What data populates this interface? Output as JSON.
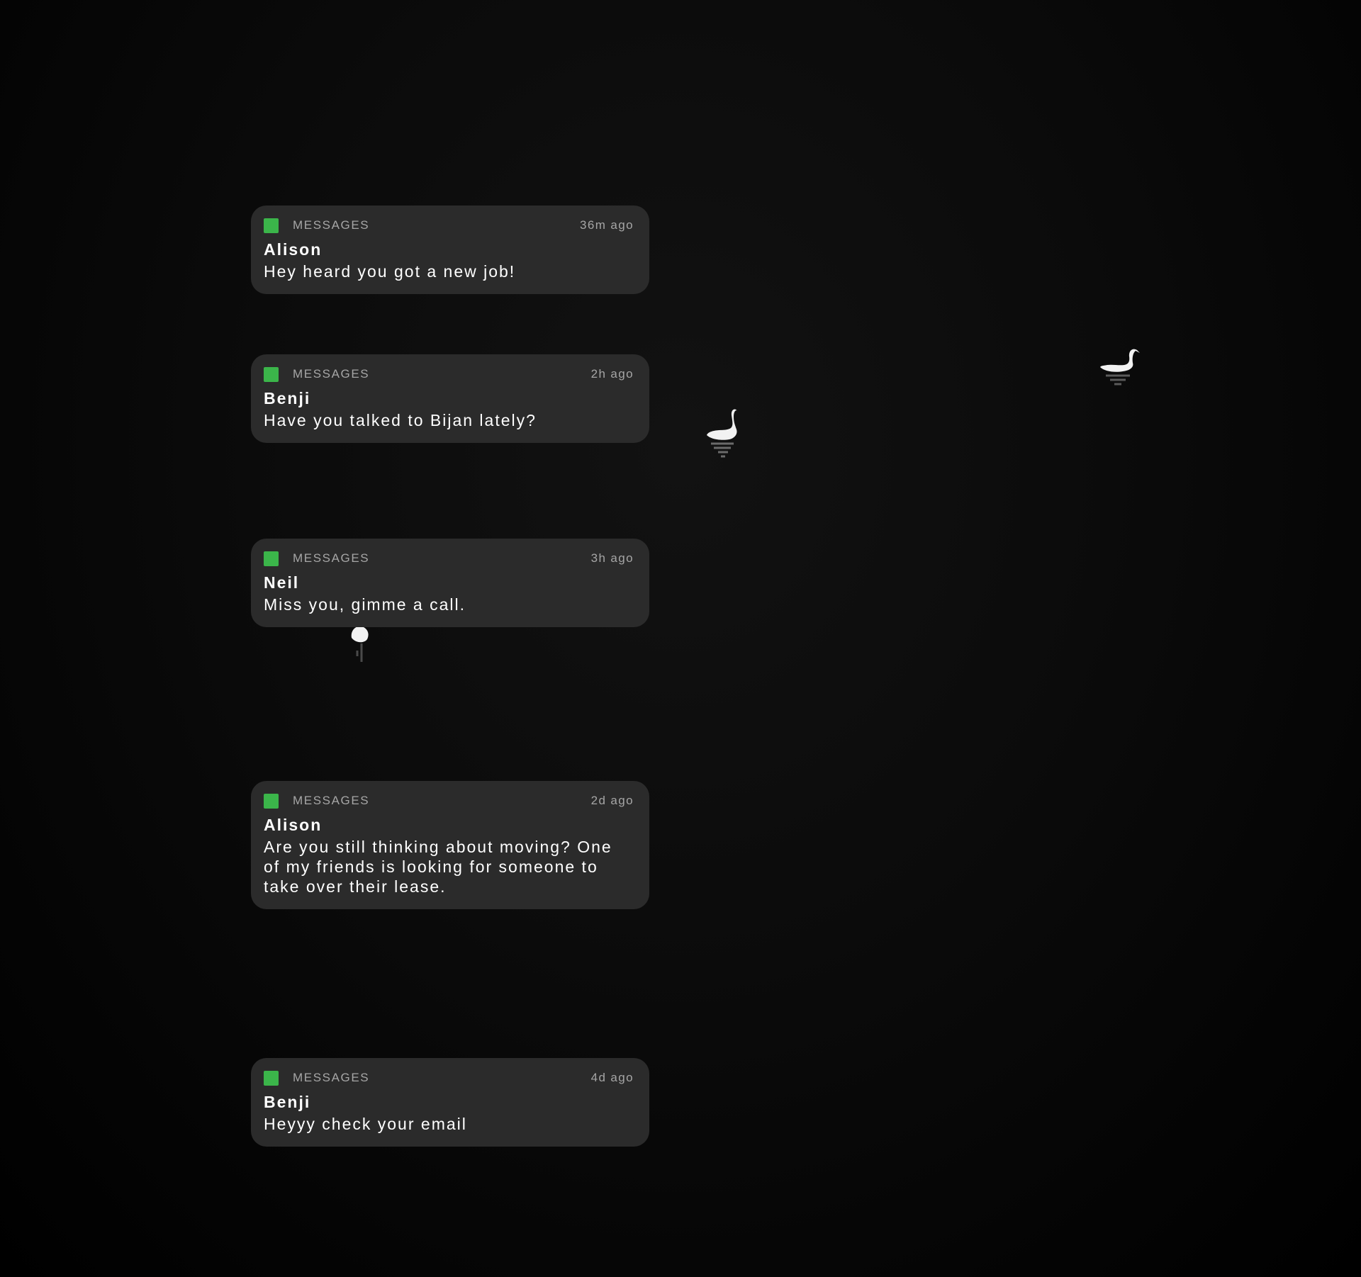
{
  "colors": {
    "background": "#000000",
    "card": "#2b2b2b",
    "app_icon": "#3bb54a",
    "meta_text": "#a6a6a6",
    "primary_text": "#ffffff"
  },
  "notifications": [
    {
      "icon": "messages-app-icon",
      "app": "MESSAGES",
      "time": "36m ago",
      "sender": "Alison",
      "message": "Hey heard you got a new job!"
    },
    {
      "icon": "messages-app-icon",
      "app": "MESSAGES",
      "time": "2h ago",
      "sender": "Benji",
      "message": "Have you talked to Bijan lately?"
    },
    {
      "icon": "messages-app-icon",
      "app": "MESSAGES",
      "time": "3h ago",
      "sender": "Neil",
      "message": "Miss you, gimme a call."
    },
    {
      "icon": "messages-app-icon",
      "app": "MESSAGES",
      "time": "2d ago",
      "sender": "Alison",
      "message": "Are you still thinking about moving? One of my friends is looking for someone to take over their lease."
    },
    {
      "icon": "messages-app-icon",
      "app": "MESSAGES",
      "time": "4d ago",
      "sender": "Benji",
      "message": "Heyyy check your email"
    }
  ]
}
